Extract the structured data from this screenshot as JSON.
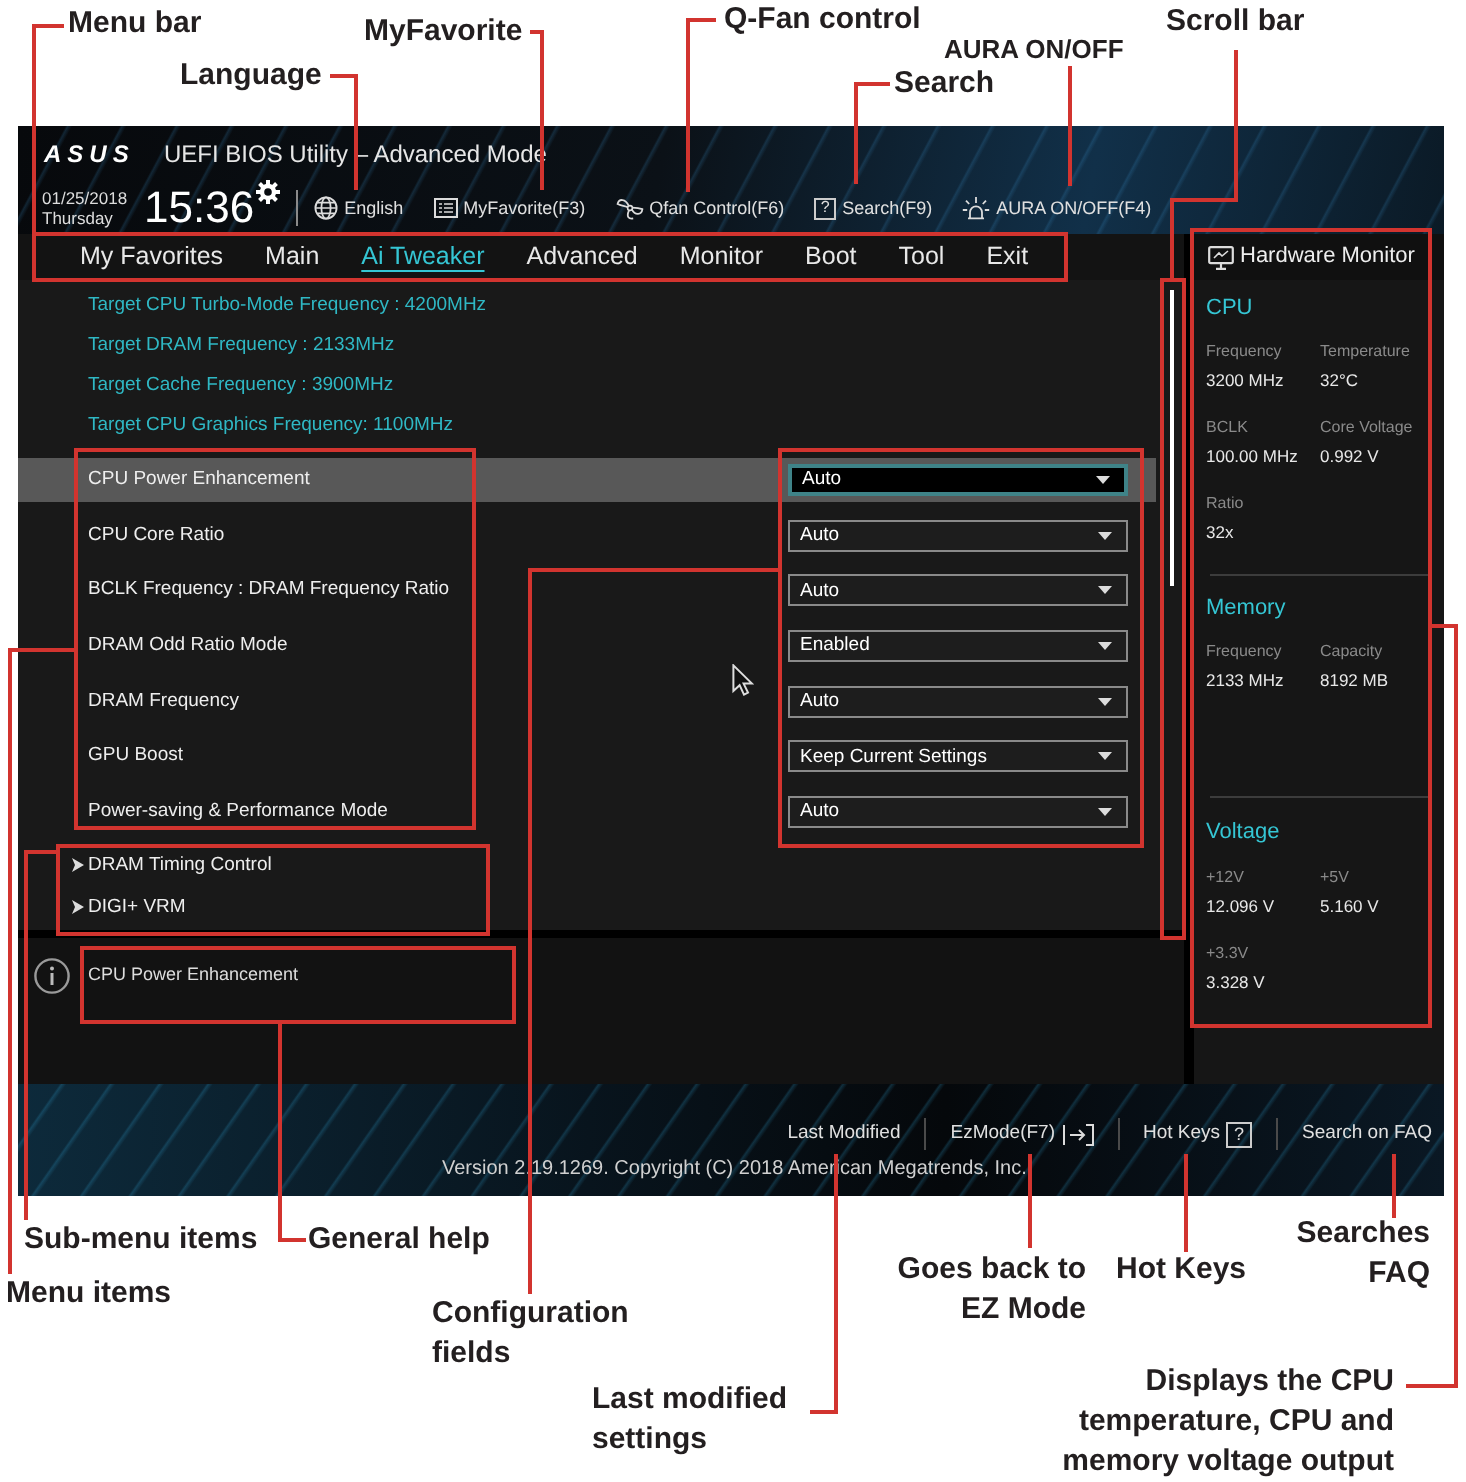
{
  "top_callouts": [
    {
      "text": "Menu bar"
    },
    {
      "text": "Language"
    },
    {
      "text": "MyFavorite"
    },
    {
      "text": "Q-Fan control"
    },
    {
      "text": "Search"
    },
    {
      "text": "AURA ON/OFF"
    },
    {
      "text": "Scroll bar"
    }
  ],
  "screen": {
    "logo": "ASUS",
    "title": "UEFI BIOS Utility – Advanced Mode",
    "date": "01/25/2018",
    "day": "Thursday",
    "time": "15:36",
    "toolbar": [
      {
        "label": "English"
      },
      {
        "label": "MyFavorite(F3)"
      },
      {
        "label": "Qfan Control(F6)"
      },
      {
        "key": "?",
        "label": "Search(F9)"
      },
      {
        "label": "AURA ON/OFF(F4)"
      }
    ],
    "tabs": [
      {
        "label": "My Favorites",
        "selected": false
      },
      {
        "label": "Main",
        "selected": false
      },
      {
        "label": "Ai Tweaker",
        "selected": true
      },
      {
        "label": "Advanced",
        "selected": false
      },
      {
        "label": "Monitor",
        "selected": false
      },
      {
        "label": "Boot",
        "selected": false
      },
      {
        "label": "Tool",
        "selected": false
      },
      {
        "label": "Exit",
        "selected": false
      }
    ],
    "info_lines": [
      "Target CPU Turbo-Mode Frequency : 4200MHz",
      "Target DRAM Frequency : 2133MHz",
      "Target Cache Frequency : 3900MHz",
      "Target CPU Graphics Frequency: 1100MHz"
    ],
    "settings": [
      {
        "label": "CPU Power Enhancement",
        "value": "Auto",
        "selected": true
      },
      {
        "label": "CPU Core Ratio",
        "value": "Auto",
        "selected": false
      },
      {
        "label": "BCLK Frequency : DRAM Frequency Ratio",
        "value": "Auto",
        "selected": false
      },
      {
        "label": "DRAM Odd Ratio Mode",
        "value": "Enabled",
        "selected": false
      },
      {
        "label": "DRAM Frequency",
        "value": "Auto",
        "selected": false
      },
      {
        "label": "GPU Boost",
        "value": "Keep Current Settings",
        "selected": false
      },
      {
        "label": "Power-saving & Performance Mode",
        "value": "Auto",
        "selected": false
      }
    ],
    "submenus": [
      {
        "label": "DRAM Timing Control"
      },
      {
        "label": "DIGI+ VRM"
      }
    ],
    "help": "CPU Power Enhancement",
    "hardware_monitor": {
      "title": "Hardware Monitor",
      "sections": [
        {
          "title": "CPU",
          "items": [
            {
              "label": "Frequency",
              "value": "3200 MHz"
            },
            {
              "label": "Temperature",
              "value": "32°C"
            },
            {
              "label": "BCLK",
              "value": "100.00 MHz"
            },
            {
              "label": "Core Voltage",
              "value": "0.992 V"
            },
            {
              "label": "Ratio",
              "value": "32x"
            }
          ]
        },
        {
          "title": "Memory",
          "items": [
            {
              "label": "Frequency",
              "value": "2133 MHz"
            },
            {
              "label": "Capacity",
              "value": "8192 MB"
            }
          ]
        },
        {
          "title": "Voltage",
          "items": [
            {
              "label": "+12V",
              "value": "12.096 V"
            },
            {
              "label": "+5V",
              "value": "5.160 V"
            },
            {
              "label": "+3.3V",
              "value": "3.328 V"
            }
          ]
        }
      ]
    },
    "footer": {
      "actions": [
        {
          "label": "Last Modified"
        },
        {
          "label": "EzMode(F7)"
        },
        {
          "key": "?",
          "label": "Hot Keys"
        },
        {
          "label": "Search on FAQ"
        }
      ],
      "copyright": "Version 2.19.1269. Copyright (C) 2018 American Megatrends, Inc."
    }
  },
  "bottom_callouts": [
    {
      "text": "Sub-menu items"
    },
    {
      "text": "General help"
    },
    {
      "text": "Searches FAQ"
    },
    {
      "text": "Menu items"
    },
    {
      "text": "Goes back to EZ Mode"
    },
    {
      "text": "Hot Keys"
    },
    {
      "text": "Configuration fields"
    },
    {
      "text": "Last modified settings"
    },
    {
      "text": "Displays the CPU temperature, CPU and memory voltage output"
    }
  ]
}
